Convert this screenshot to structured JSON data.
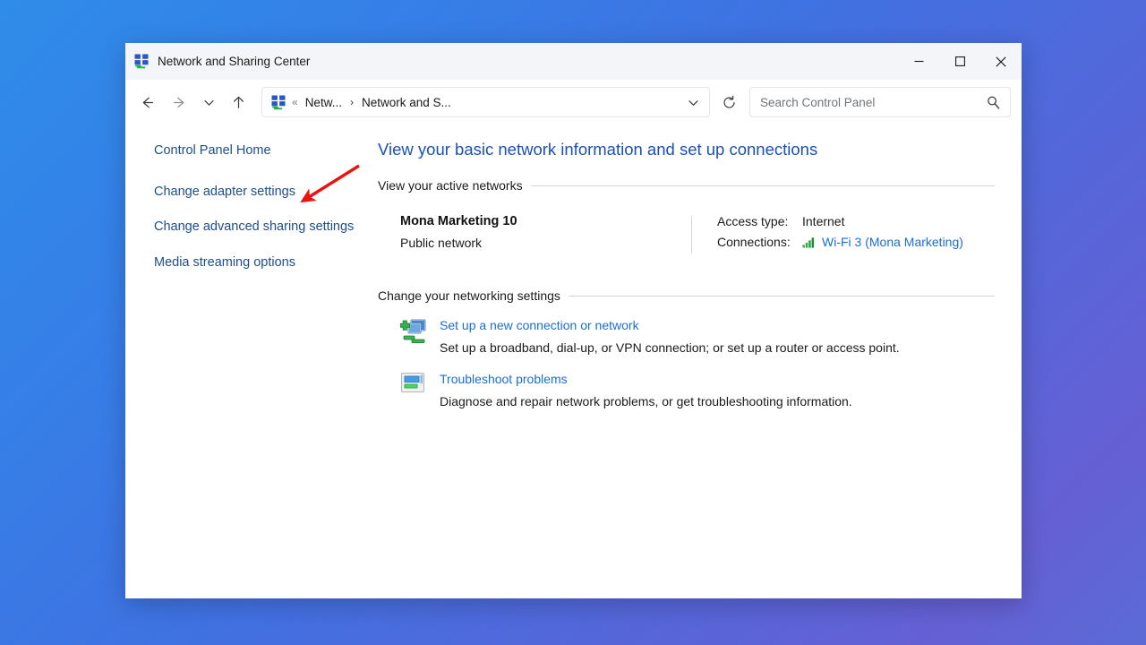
{
  "window": {
    "title": "Network and Sharing Center",
    "app_icon": "network-icon",
    "controls": {
      "minimize": "Minimize",
      "maximize": "Maximize",
      "close": "Close"
    }
  },
  "navbar": {
    "back": "Back",
    "forward": "Forward",
    "recent": "Recent locations",
    "up": "Up",
    "refresh": "Refresh",
    "breadcrumb": {
      "icon": "network-icon",
      "separator_dots": "«",
      "items": [
        "Netw...",
        "Network and S..."
      ],
      "chevron": "›",
      "dropdown": "Previous locations"
    },
    "search": {
      "placeholder": "Search Control Panel",
      "value": "",
      "icon": "search-icon"
    }
  },
  "sidebar": {
    "items": [
      {
        "label": "Control Panel Home"
      },
      {
        "label": "Change adapter settings"
      },
      {
        "label": "Change advanced sharing settings"
      },
      {
        "label": "Media streaming options"
      }
    ]
  },
  "main": {
    "heading": "View your basic network information and set up connections",
    "active_networks": {
      "section_title": "View your active networks",
      "network_name": "Mona Marketing 10",
      "network_type": "Public network",
      "details": [
        {
          "key": "Access type:",
          "value": "Internet",
          "icon": null,
          "is_link": false
        },
        {
          "key": "Connections:",
          "value": "Wi-Fi 3 (Mona Marketing)",
          "icon": "wifi-signal-icon",
          "is_link": true
        }
      ]
    },
    "networking_settings": {
      "section_title": "Change your networking settings",
      "items": [
        {
          "icon": "new-connection-icon",
          "link": "Set up a new connection or network",
          "description": "Set up a broadband, dial-up, or VPN connection; or set up a router or access point."
        },
        {
          "icon": "troubleshoot-icon",
          "link": "Troubleshoot problems",
          "description": "Diagnose and repair network problems, or get troubleshooting information."
        }
      ]
    }
  },
  "annotation": {
    "type": "arrow",
    "color": "#e81123",
    "points_to": "Change adapter settings"
  },
  "colors": {
    "heading_blue": "#1a50b8",
    "sidebar_link": "#1d4e89",
    "content_link": "#1a6fd4",
    "annotation_red": "#e81123",
    "titlebar_bg": "#f3f5f8"
  }
}
